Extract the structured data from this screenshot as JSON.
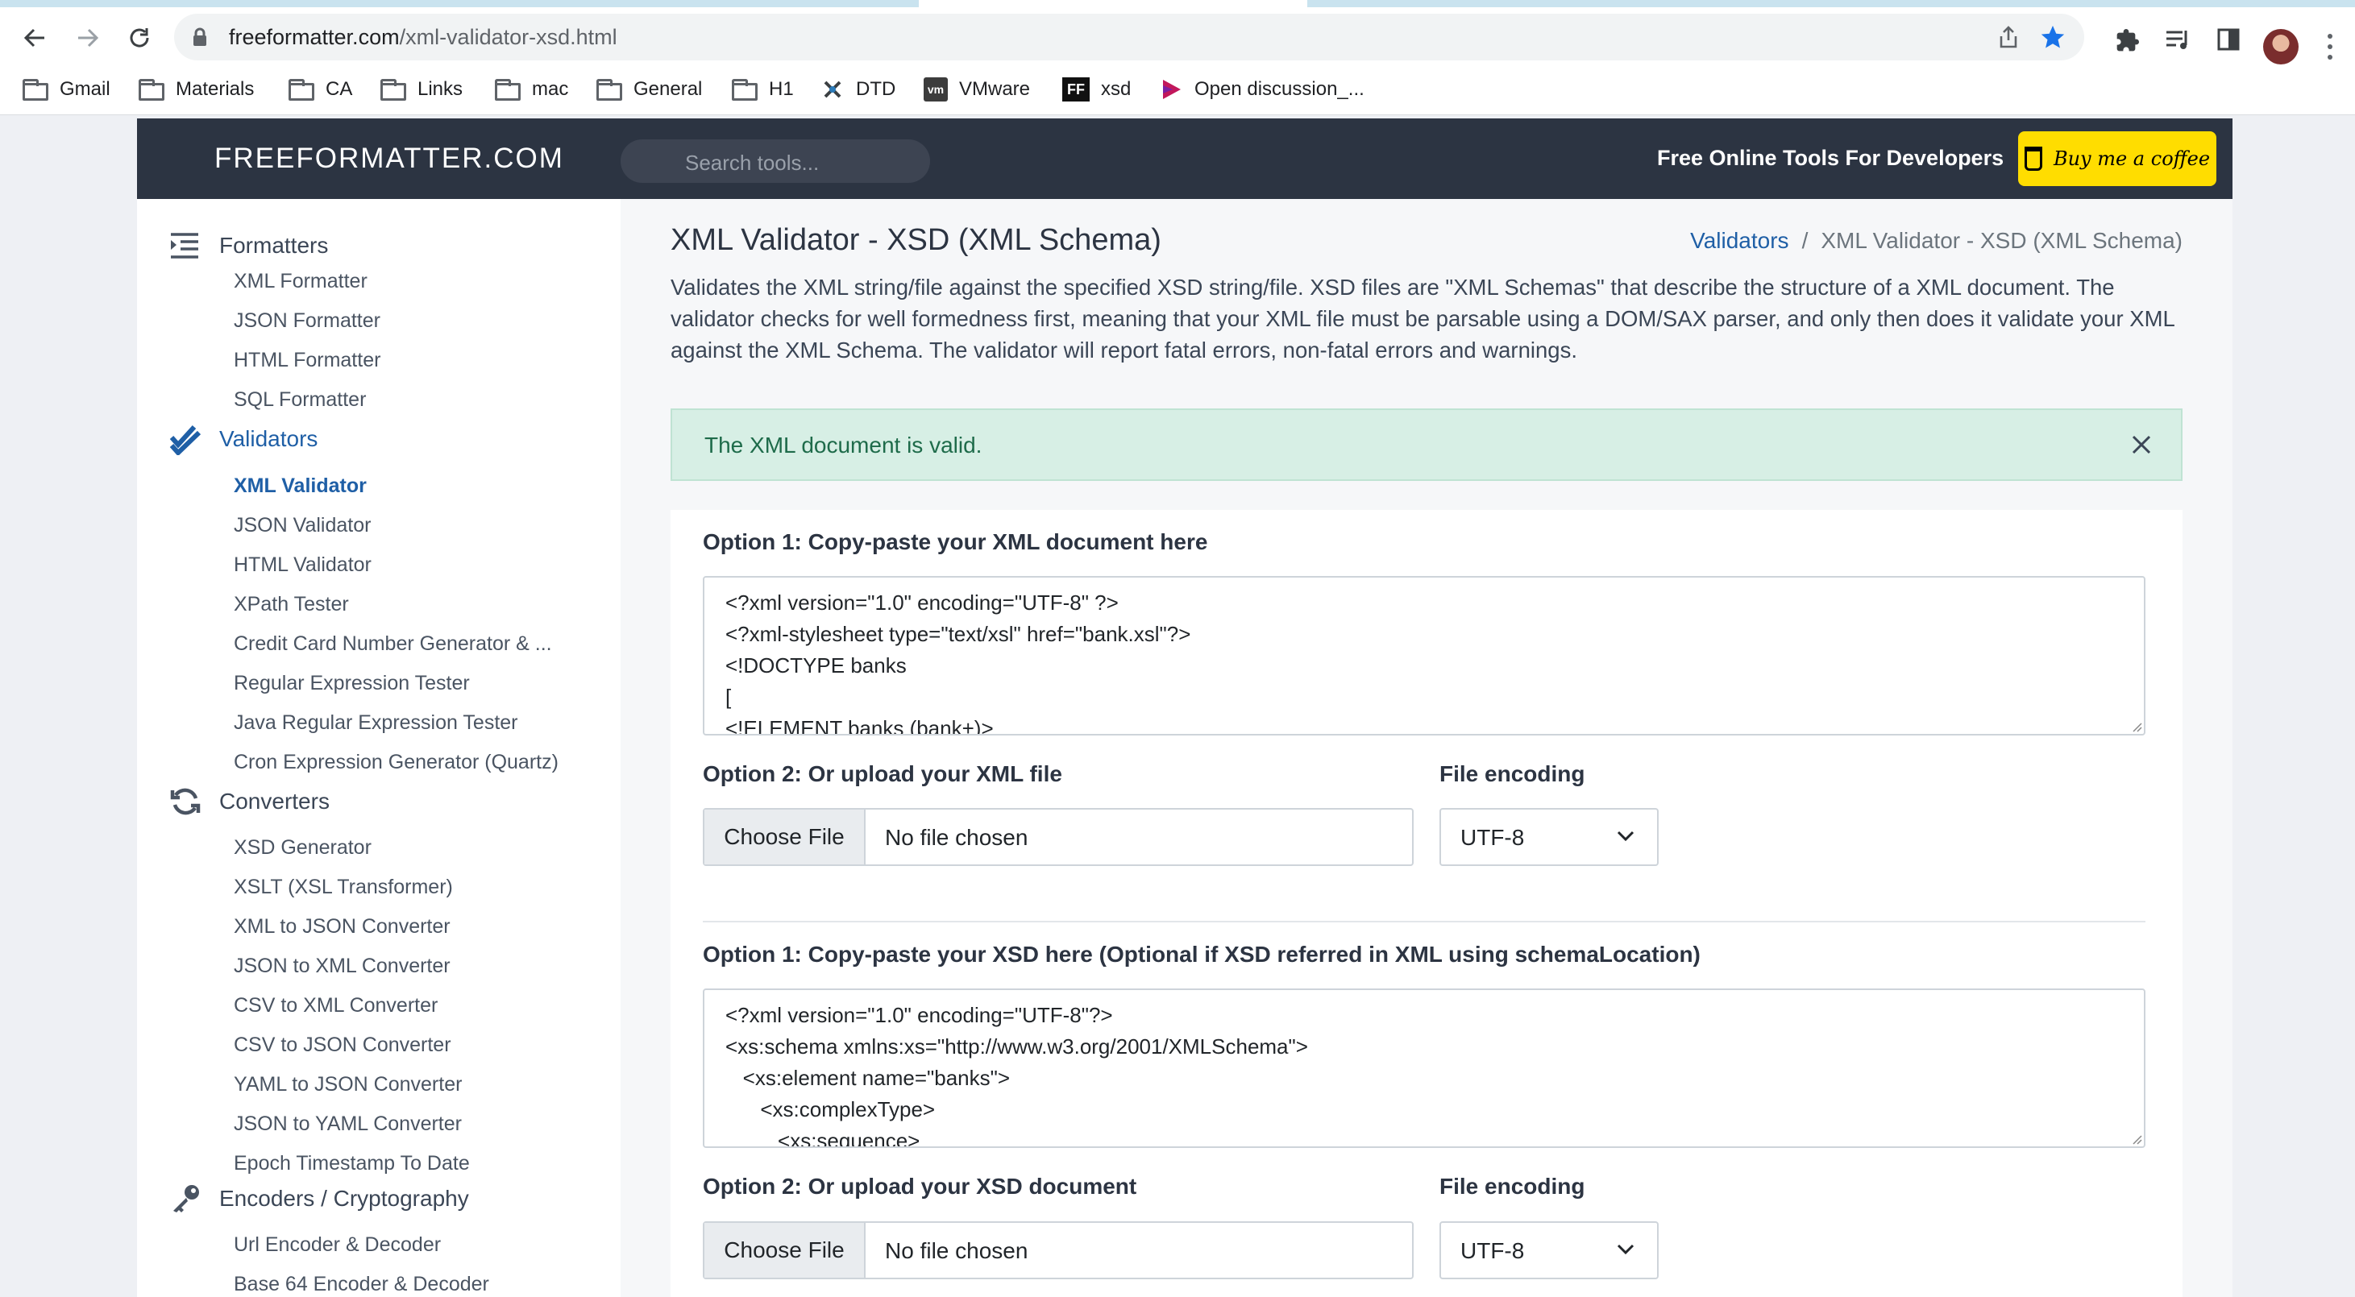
{
  "browser": {
    "url_host": "freeformatter.com",
    "url_path": "/xml-validator-xsd.html",
    "bookmarks": [
      {
        "label": "Gmail",
        "icon": "folder-icon"
      },
      {
        "label": "Materials",
        "icon": "folder-icon"
      },
      {
        "label": "CA",
        "icon": "folder-icon"
      },
      {
        "label": "Links",
        "icon": "folder-icon"
      },
      {
        "label": "mac",
        "icon": "folder-icon"
      },
      {
        "label": "General",
        "icon": "folder-icon"
      },
      {
        "label": "H1",
        "icon": "folder-icon"
      },
      {
        "label": "DTD",
        "icon": "dtd-favicon"
      },
      {
        "label": "VMware",
        "icon": "vmware-favicon"
      },
      {
        "label": "xsd",
        "icon": "ff-favicon"
      },
      {
        "label": "Open discussion_...",
        "icon": "play-favicon"
      }
    ],
    "vmware_badge": "vm",
    "ff_badge": "FF"
  },
  "header": {
    "logo": "FREEFORMATTER.COM",
    "search_placeholder": "Search tools...",
    "tagline": "Free Online Tools For Developers",
    "coffee_button": "Buy me a coffee"
  },
  "sidebar": {
    "formatters": {
      "label": "Formatters",
      "items": [
        "XML Formatter",
        "JSON Formatter",
        "HTML Formatter",
        "SQL Formatter"
      ]
    },
    "validators": {
      "label": "Validators",
      "items": [
        "XML Validator",
        "JSON Validator",
        "HTML Validator",
        "XPath Tester",
        "Credit Card Number Generator & ...",
        "Regular Expression Tester",
        "Java Regular Expression Tester",
        "Cron Expression Generator (Quartz)"
      ]
    },
    "converters": {
      "label": "Converters",
      "items": [
        "XSD Generator",
        "XSLT (XSL Transformer)",
        "XML to JSON Converter",
        "JSON to XML Converter",
        "CSV to XML Converter",
        "CSV to JSON Converter",
        "YAML to JSON Converter",
        "JSON to YAML Converter",
        "Epoch Timestamp To Date"
      ]
    },
    "encoders": {
      "label": "Encoders / Cryptography",
      "items": [
        "Url Encoder & Decoder",
        "Base 64 Encoder & Decoder"
      ]
    }
  },
  "main": {
    "title": "XML Validator - XSD (XML Schema)",
    "breadcrumb": {
      "parent": "Validators",
      "separator": "/",
      "current": "XML Validator - XSD (XML Schema)"
    },
    "description": "Validates the XML string/file against the specified XSD string/file. XSD files are \"XML Schemas\" that describe the structure of a XML document. The validator checks for well formedness first, meaning that your XML file must be parsable using a DOM/SAX parser, and only then does it validate your XML against the XML Schema. The validator will report fatal errors, non-fatal errors and warnings.",
    "alert": "The XML document is valid.",
    "xml_section": {
      "option1_label": "Option 1: Copy-paste your XML document here",
      "lines": [
        "<?xml version=\"1.0\" encoding=\"UTF-8\" ?>",
        "<?xml-stylesheet type=\"text/xsl\" href=\"bank.xsl\"?>",
        "<!DOCTYPE banks",
        "[",
        "<!ELEMENT banks (bank+)>"
      ],
      "option2_label": "Option 2: Or upload your XML file",
      "choose_file": "Choose File",
      "no_file": "No file chosen",
      "encoding_label": "File encoding",
      "encoding_value": "UTF-8"
    },
    "xsd_section": {
      "option1_label": "Option 1: Copy-paste your XSD here (Optional if XSD referred in XML using schemaLocation)",
      "lines": [
        "<?xml version=\"1.0\" encoding=\"UTF-8\"?>",
        "<xs:schema xmlns:xs=\"http://www.w3.org/2001/XMLSchema\">",
        "   <xs:element name=\"banks\">",
        "      <xs:complexType>",
        "         <xs:sequence>"
      ],
      "option2_label": "Option 2: Or upload your XSD document",
      "choose_file": "Choose File",
      "no_file": "No file chosen",
      "encoding_label": "File encoding",
      "encoding_value": "UTF-8"
    }
  },
  "colors": {
    "header_bg": "#2c3442",
    "accent": "#1f5fa6",
    "coffee": "#ffdd00",
    "alert_bg": "#d7efe5",
    "alert_text": "#1e6b4a"
  }
}
